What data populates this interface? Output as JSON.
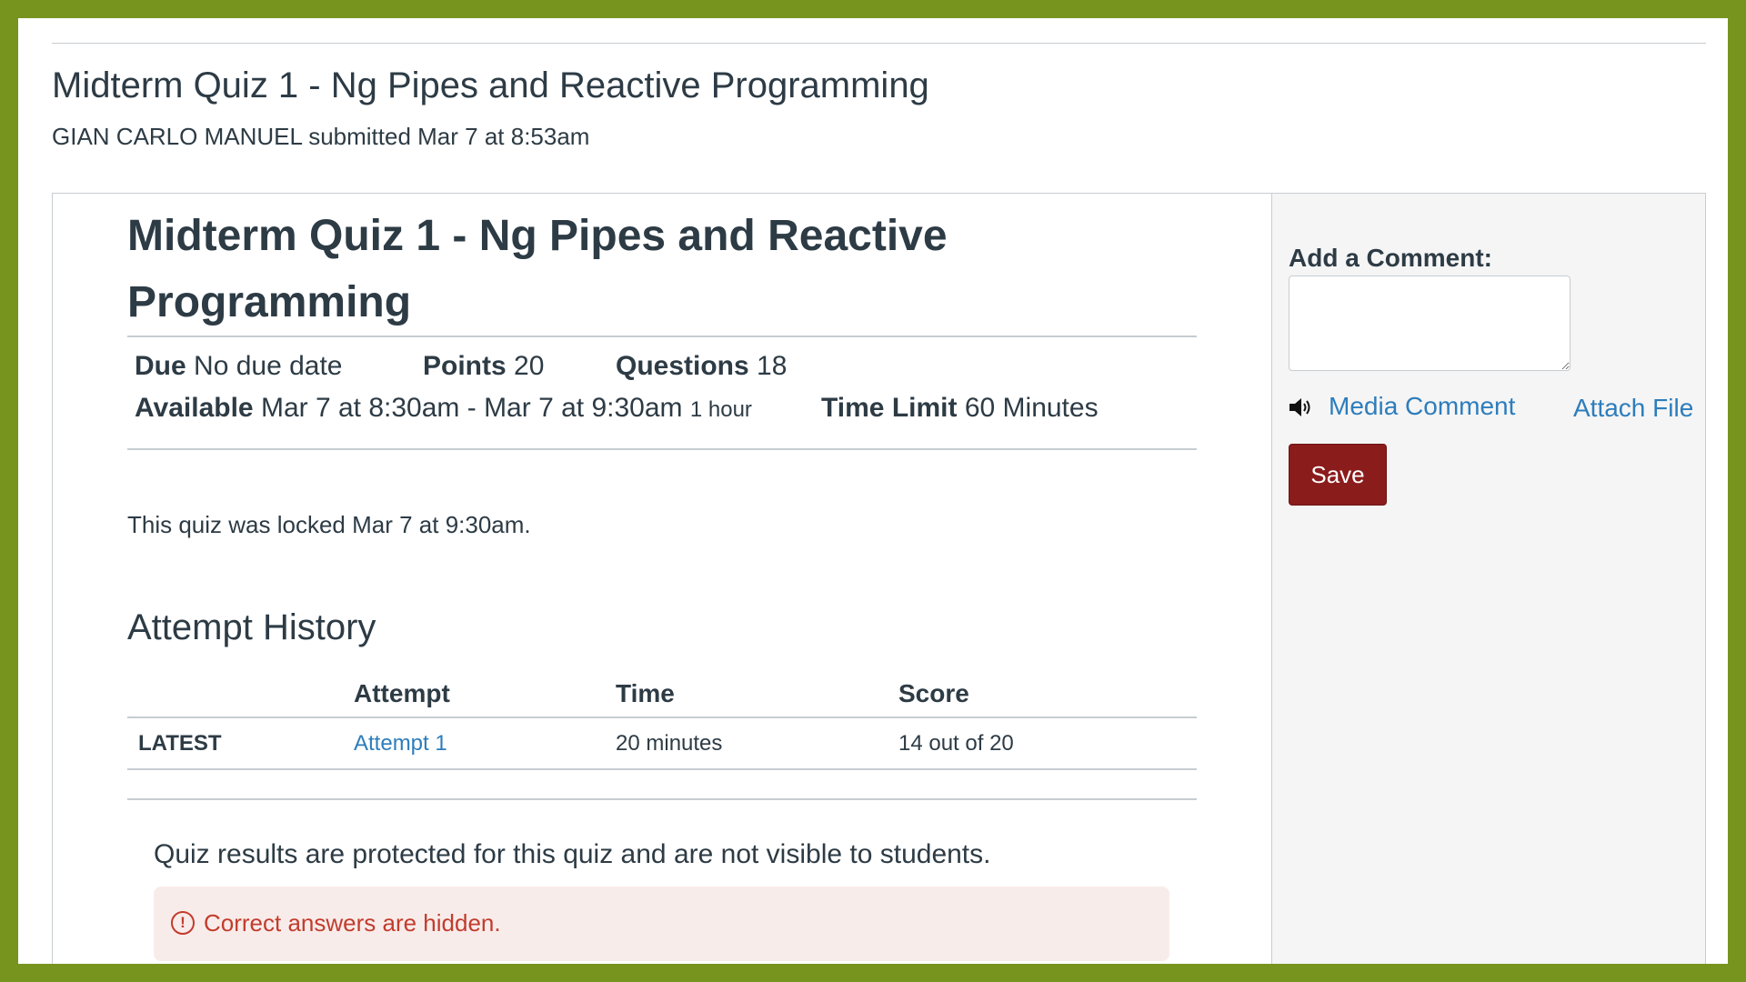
{
  "header": {
    "page_title": "Midterm Quiz 1 - Ng Pipes and Reactive Programming",
    "submitted_line": "GIAN CARLO MANUEL submitted Mar 7 at 8:53am"
  },
  "quiz": {
    "title": "Midterm Quiz 1 - Ng Pipes and Reactive Programming",
    "due_label": "Due",
    "due_value": "No due date",
    "points_label": "Points",
    "points_value": "20",
    "questions_label": "Questions",
    "questions_value": "18",
    "available_label": "Available",
    "available_value": "Mar 7 at 8:30am - Mar 7 at 9:30am",
    "available_duration": "1 hour",
    "time_limit_label": "Time Limit",
    "time_limit_value": "60 Minutes",
    "locked_message": "This quiz was locked Mar 7 at 9:30am."
  },
  "attempt_history": {
    "heading": "Attempt History",
    "columns": [
      "",
      "Attempt",
      "Time",
      "Score"
    ],
    "rows": [
      {
        "tag": "LATEST",
        "attempt": "Attempt 1",
        "time": "20 minutes",
        "score": "14 out of 20"
      }
    ]
  },
  "results": {
    "protected_text": "Quiz results are protected for this quiz and are not visible to students.",
    "alert_icon": "exclamation-circle-icon",
    "alert_text": "Correct answers are hidden."
  },
  "comments": {
    "label": "Add a Comment:",
    "value": "",
    "media_icon": "speaker-icon",
    "media_label": "Media Comment",
    "attach_label": "Attach File",
    "save_label": "Save"
  },
  "colors": {
    "frame_border": "#77941f",
    "link": "#2d7dbc",
    "save_button": "#8b1c1c",
    "alert_text": "#c23c2d",
    "alert_background": "#f8ecea"
  }
}
